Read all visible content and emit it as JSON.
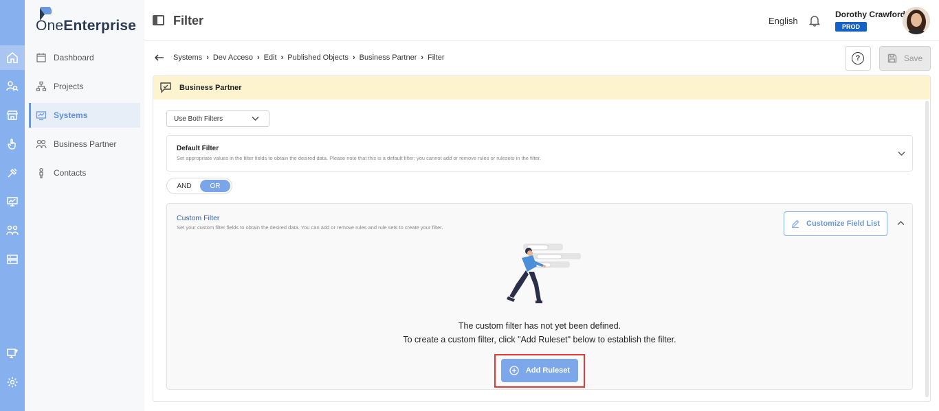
{
  "brand": {
    "name_part1": "One",
    "name_part2": "Enterprise"
  },
  "rail": {
    "icons": [
      "home-icon",
      "people-search-icon",
      "store-icon",
      "touch-icon",
      "tools-icon",
      "monitor-chart-icon",
      "team-icon",
      "server-icon",
      "remote-desktop-icon",
      "settings-icon"
    ]
  },
  "sidebar": {
    "items": [
      {
        "label": "Dashboard",
        "icon": "calendar-icon"
      },
      {
        "label": "Projects",
        "icon": "hierarchy-icon"
      },
      {
        "label": "Systems",
        "icon": "systems-icon"
      },
      {
        "label": "Business Partner",
        "icon": "partner-icon"
      },
      {
        "label": "Contacts",
        "icon": "person-icon"
      }
    ]
  },
  "header": {
    "title": "Filter",
    "language": "English",
    "user_name": "Dorothy Crawford",
    "env_badge": "PROD"
  },
  "breadcrumb": [
    "Systems",
    "Dev Acceso",
    "Edit",
    "Published Objects",
    "Business Partner",
    "Filter"
  ],
  "toolbar": {
    "help_label": "?",
    "save_label": "Save"
  },
  "card": {
    "title": "Business Partner",
    "filter_mode": "Use Both Filters",
    "default_filter": {
      "title": "Default Filter",
      "description": "Set appropriate values in the filter fields to obtain the desired data. Please note that this is a default filter; you cannot add or remove rules or rulesets in the filter."
    },
    "logic": {
      "and_label": "AND",
      "or_label": "OR",
      "selected": "OR"
    },
    "custom_filter": {
      "title": "Custom Filter",
      "description": "Set your custom filter fields to obtain the desired data. You can add or remove rules and rule sets to create your filter.",
      "customize_label": "Customize Field List",
      "empty_line1": "The custom filter has not yet been defined.",
      "empty_line2": "To create a custom filter, click \"Add Ruleset\" below to establish the filter.",
      "add_ruleset_label": "Add Ruleset"
    }
  },
  "colors": {
    "rail": "#86b0ee",
    "accent": "#7ca7ea",
    "badge": "#1662c4",
    "card_header": "#fdf4cf",
    "highlight": "#e53935"
  }
}
